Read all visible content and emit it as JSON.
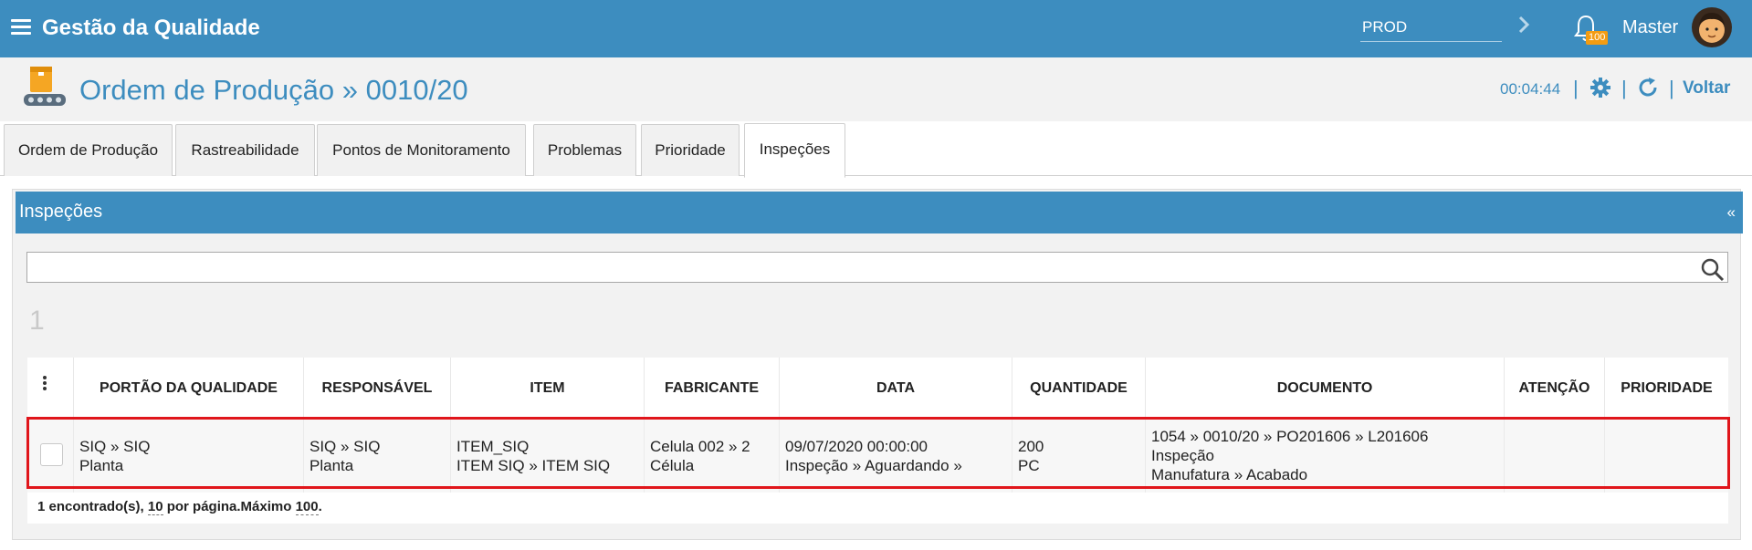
{
  "app": {
    "title": "Gestão da Qualidade"
  },
  "header": {
    "environment": "PROD",
    "notification_count": "100",
    "user_name": "Master"
  },
  "page": {
    "title": "Ordem de Produção » 0010/20",
    "timer": "00:04:44",
    "back_label": "Voltar",
    "separator": "|"
  },
  "tabs": [
    {
      "label": "Ordem de Produção"
    },
    {
      "label": "Rastreabilidade"
    },
    {
      "label": "Pontos de Monitoramento"
    },
    {
      "label": "Problemas"
    },
    {
      "label": "Prioridade"
    },
    {
      "label": "Inspeções",
      "active": true
    }
  ],
  "panel": {
    "title": "Inspeções",
    "collapse_glyph": "«",
    "search_value": "",
    "page_number": "1"
  },
  "grid": {
    "columns": [
      "PORTÃO DA QUALIDADE",
      "RESPONSÁVEL",
      "ITEM",
      "FABRICANTE",
      "DATA",
      "QUANTIDADE",
      "DOCUMENTO",
      "ATENÇÃO",
      "PRIORIDADE"
    ],
    "rows": [
      {
        "portao": [
          "SIQ » SIQ",
          "Planta"
        ],
        "responsavel": [
          "SIQ » SIQ",
          "Planta"
        ],
        "item": [
          "ITEM_SIQ",
          "ITEM SIQ » ITEM SIQ"
        ],
        "fabricante": [
          "Celula 002 » 2",
          "Célula"
        ],
        "data": [
          "09/07/2020 00:00:00",
          "Inspeção » Aguardando »"
        ],
        "quantidade": [
          "200",
          "PC"
        ],
        "documento": [
          "1054 » 0010/20 » PO201606 » L201606",
          "Inspeção",
          "Manufatura » Acabado"
        ],
        "atencao": "",
        "prioridade": ""
      }
    ],
    "footer": {
      "found": "1 encontrado(s),",
      "per_page_value": "10",
      "per_page_text": "por página.Máximo",
      "max_value": "100",
      "end": "."
    }
  },
  "colors": {
    "brand": "#3d8dbf",
    "highlight": "#e0151b",
    "badge": "#f39c12"
  }
}
